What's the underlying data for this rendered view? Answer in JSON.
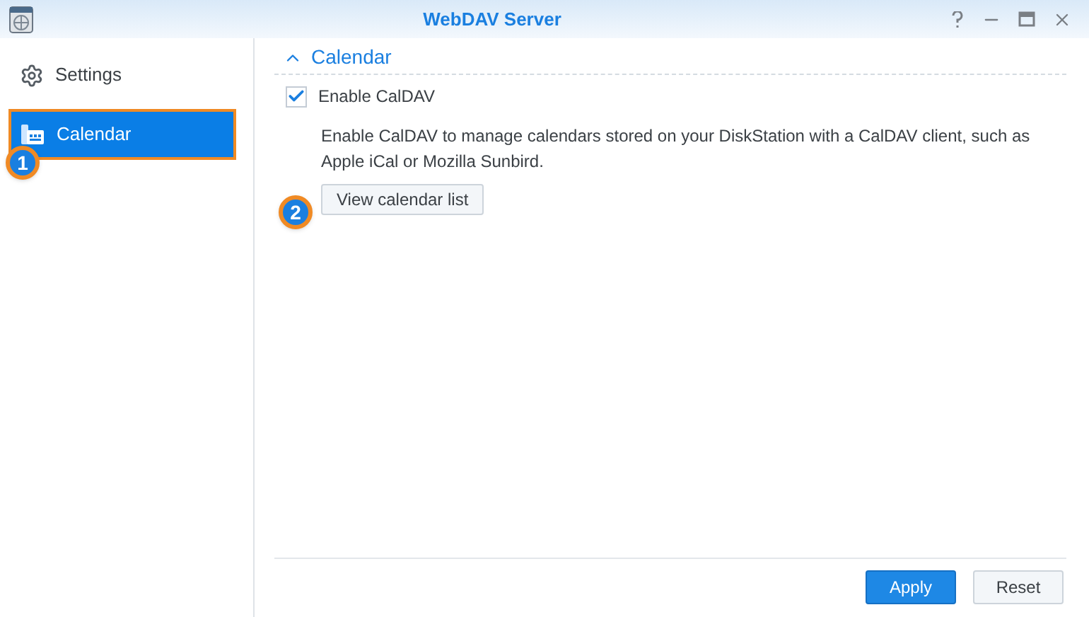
{
  "window": {
    "title": "WebDAV Server"
  },
  "sidebar": {
    "items": [
      {
        "label": "Settings",
        "kind": "gear",
        "selected": false,
        "highlighted": false
      },
      {
        "label": "Calendar",
        "kind": "calendar",
        "selected": true,
        "highlighted": true,
        "callout": "1"
      }
    ]
  },
  "section": {
    "title": "Calendar",
    "expanded": true,
    "checkbox": {
      "label": "Enable CalDAV",
      "checked": true
    },
    "description": "Enable CalDAV to manage calendars stored on your DiskStation with a CalDAV client, such as Apple iCal or Mozilla Sunbird.",
    "button": {
      "label": "View calendar list",
      "callout": "2"
    }
  },
  "footer": {
    "buttons": [
      {
        "label": "Apply",
        "kind": "primary"
      },
      {
        "label": "Reset",
        "kind": "secondary"
      }
    ]
  }
}
